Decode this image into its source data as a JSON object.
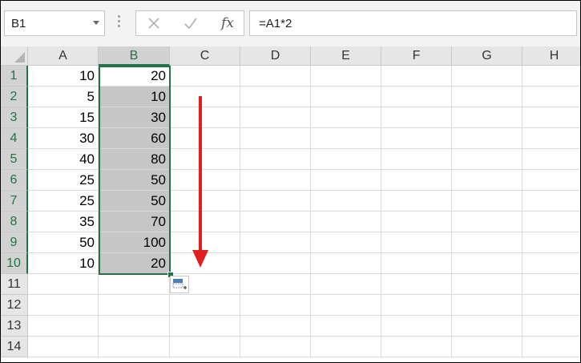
{
  "name_box": {
    "value": "B1",
    "dropdown_icon": "chevron-down-icon"
  },
  "formula_bar": {
    "cancel_icon": "cancel-x-icon",
    "enter_icon": "check-icon",
    "fx_label": "fx",
    "formula": "=A1*2"
  },
  "columns": [
    "A",
    "B",
    "C",
    "D",
    "E",
    "F",
    "G",
    "H"
  ],
  "rows": [
    "1",
    "2",
    "3",
    "4",
    "5",
    "6",
    "7",
    "8",
    "9",
    "10",
    "11",
    "12",
    "13",
    "14"
  ],
  "column_a": [
    "10",
    "5",
    "15",
    "30",
    "40",
    "25",
    "25",
    "35",
    "50",
    "10"
  ],
  "column_b": [
    "20",
    "10",
    "30",
    "60",
    "80",
    "50",
    "50",
    "70",
    "100",
    "20"
  ],
  "selection": {
    "range": "B1:B10",
    "accent_color": "#217346",
    "fill_color": "#c6c6c6"
  },
  "annotation": {
    "icon": "down-arrow-icon",
    "color": "#e02020"
  },
  "autofill_options_icon": "autofill-options-icon"
}
